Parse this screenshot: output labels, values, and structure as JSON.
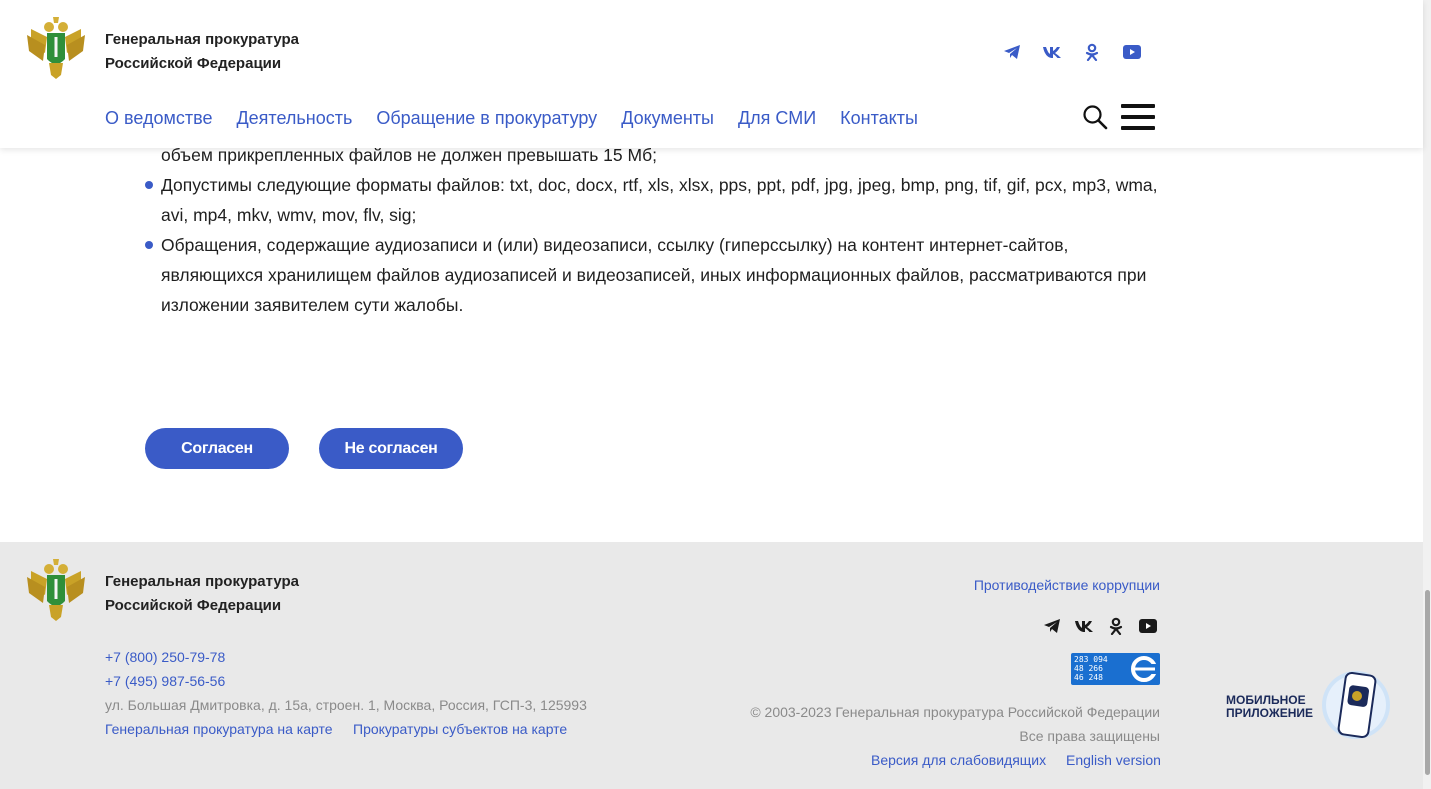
{
  "header": {
    "org_line1": "Генеральная прокуратура",
    "org_line2": "Российской Федерации",
    "social": [
      "telegram-icon",
      "vk-icon",
      "odnoklassniki-icon",
      "youtube-icon"
    ],
    "nav": [
      "О ведомстве",
      "Деятельность",
      "Обращение в прокуратуру",
      "Документы",
      "Для СМИ",
      "Контакты"
    ]
  },
  "content": {
    "line_partial": "объем прикрепленных файлов не должен превышать 15 Мб;",
    "bullets": [
      "Допустимы следующие форматы файлов: txt, doc, docx, rtf, xls, xlsx, pps, ppt, pdf, jpg, jpeg, bmp, png, tif, gif, pcx, mp3, wma, avi, mp4, mkv, wmv, mov, flv, sig;",
      "Обращения, содержащие аудиозаписи и (или) видеозаписи, ссылку (гиперссылку) на контент интернет-сайтов, являющихся хранилищем файлов аудиозаписей и видеозаписей, иных информационных файлов, рассматриваются при изложении заявителем сути жалобы."
    ],
    "agree_label": "Согласен",
    "disagree_label": "Не согласен"
  },
  "footer": {
    "org_line1": "Генеральная прокуратура",
    "org_line2": "Российской Федерации",
    "phone1": "+7 (800) 250-79-78",
    "phone2": "+7 (495) 987-56-56",
    "address": "ул. Большая Дмитровка, д. 15а, строен. 1, Москва, Россия, ГСП-3, 125993",
    "map_link": "Генеральная прокуратура на карте",
    "subjects_link": "Прокуратуры субъектов на карте",
    "anticorruption": "Противодействие коррупции",
    "counter": [
      "283 094",
      "48 266",
      "46 248"
    ],
    "copyright": "© 2003-2023 Генеральная прокуратура Российской Федерации",
    "rights": "Все права защищены",
    "accessible_version": "Версия для слабовидящих",
    "english_version": "English version",
    "mobile_line1": "МОБИЛЬНОЕ",
    "mobile_line2": "ПРИЛОЖЕНИЕ"
  },
  "colors": {
    "accent": "#3a5bc7",
    "footer_bg": "#e9e9e9",
    "gold": "#c9a227",
    "green": "#2f8f3a"
  }
}
